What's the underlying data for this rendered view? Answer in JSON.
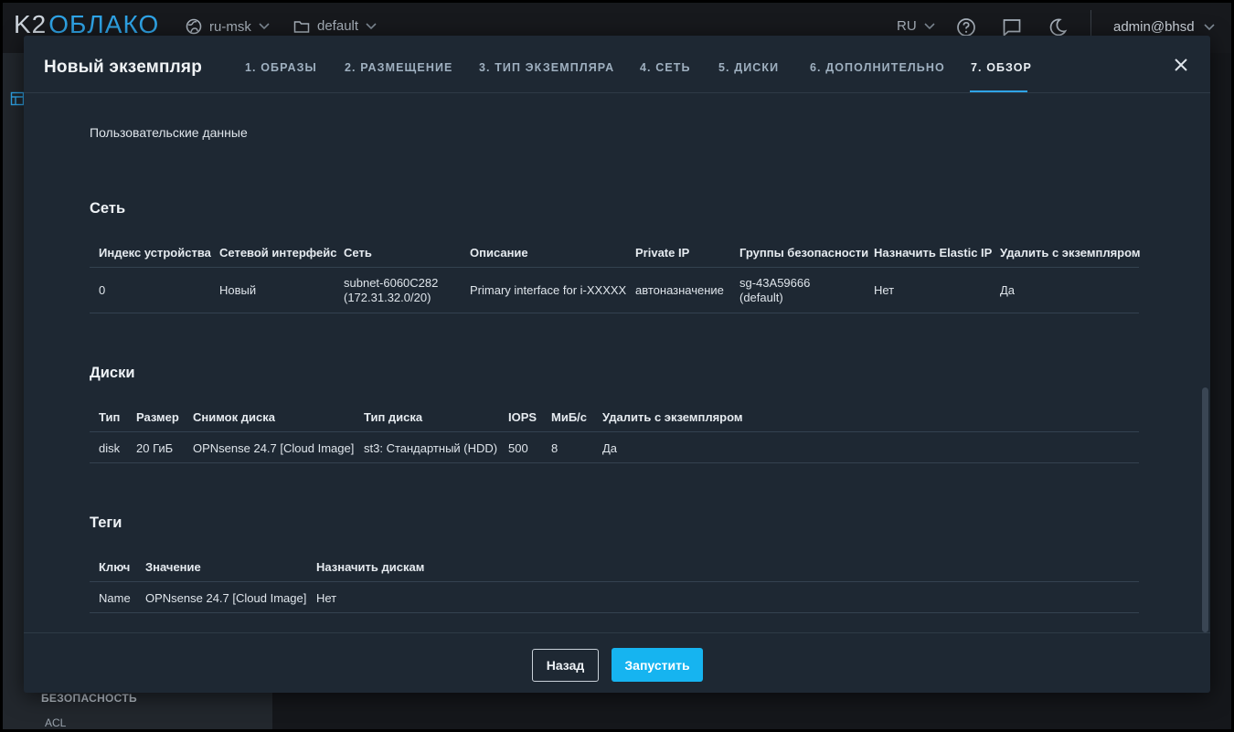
{
  "topbar": {
    "logo_k2": "K2",
    "logo_cloud": "ОБЛАКО",
    "region": "ru-msk",
    "project": "default",
    "language": "RU",
    "user": "admin@bhsd"
  },
  "background": {
    "sidebar_section": "БЕЗОПАСНОСТЬ",
    "sidebar_link": "ACL"
  },
  "modal": {
    "title": "Новый экземпляр",
    "steps": [
      {
        "label": "1. ОБРАЗЫ"
      },
      {
        "label": "2. РАЗМЕЩЕНИЕ"
      },
      {
        "label": "3. ТИП ЭКЗЕМПЛЯРА"
      },
      {
        "label": "4. СЕТЬ"
      },
      {
        "label": "5. ДИСКИ"
      },
      {
        "label": "6. ДОПОЛНИТЕЛЬНО"
      },
      {
        "label": "7. ОБЗОР"
      }
    ],
    "active_step": 6,
    "user_data_label": "Пользовательские данные",
    "network": {
      "title": "Сеть",
      "headers": [
        "Индекс устройства",
        "Сетевой интерфейс",
        "Сеть",
        "Описание",
        "Private IP",
        "Группы безопасности",
        "Назначить Elastic IP",
        "Удалить с экземпляром"
      ],
      "row": {
        "index": "0",
        "interface": "Новый",
        "subnet_line1": "subnet-6060C282",
        "subnet_line2": "(172.31.32.0/20)",
        "description": "Primary interface for i-XXXXX",
        "private_ip": "автоназначение",
        "sg_line1": "sg-43A59666",
        "sg_line2": "(default)",
        "elastic_ip": "Нет",
        "delete": "Да"
      }
    },
    "disks": {
      "title": "Диски",
      "headers": [
        "Тип",
        "Размер",
        "Снимок диска",
        "Тип диска",
        "IOPS",
        "МиБ/с",
        "Удалить с экземпляром"
      ],
      "row": [
        "disk",
        "20 ГиБ",
        "OPNsense 24.7 [Cloud Image]",
        "st3: Стандартный (HDD)",
        "500",
        "8",
        "Да"
      ]
    },
    "tags": {
      "title": "Теги",
      "headers": [
        "Ключ",
        "Значение",
        "Назначить дискам"
      ],
      "row": [
        "Name",
        "OPNsense 24.7 [Cloud Image]",
        "Нет"
      ]
    },
    "footer": {
      "back_label": "Назад",
      "launch_label": "Запустить"
    }
  },
  "colors": {
    "accent": "#16b4f0",
    "tab_underline": "#2fa4e7",
    "modal_bg": "#1e2833"
  }
}
